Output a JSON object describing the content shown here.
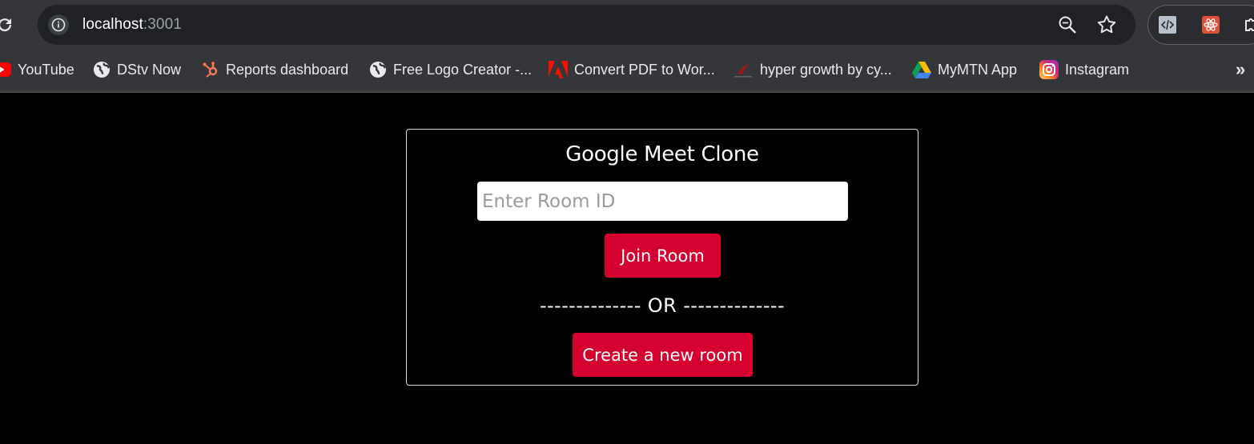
{
  "browser": {
    "url_host": "localhost",
    "url_port": ":3001"
  },
  "bookmarks": [
    {
      "label": "YouTube",
      "icon": "youtube-icon"
    },
    {
      "label": "DStv Now",
      "icon": "globe-icon"
    },
    {
      "label": "Reports dashboard",
      "icon": "hubspot-icon"
    },
    {
      "label": "Free Logo Creator -...",
      "icon": "globe-icon"
    },
    {
      "label": "Convert PDF to Wor...",
      "icon": "adobe-icon"
    },
    {
      "label": "hyper growth by cy...",
      "icon": "page-icon"
    },
    {
      "label": "MyMTN App",
      "icon": "google-drive-icon"
    },
    {
      "label": "Instagram",
      "icon": "instagram-icon"
    }
  ],
  "page": {
    "title": "Google Meet Clone",
    "room_input_placeholder": "Enter Room ID",
    "join_label": "Join Room",
    "or_text": "-------------- OR --------------",
    "create_label": "Create a new room",
    "accent_color": "#d6002f"
  }
}
